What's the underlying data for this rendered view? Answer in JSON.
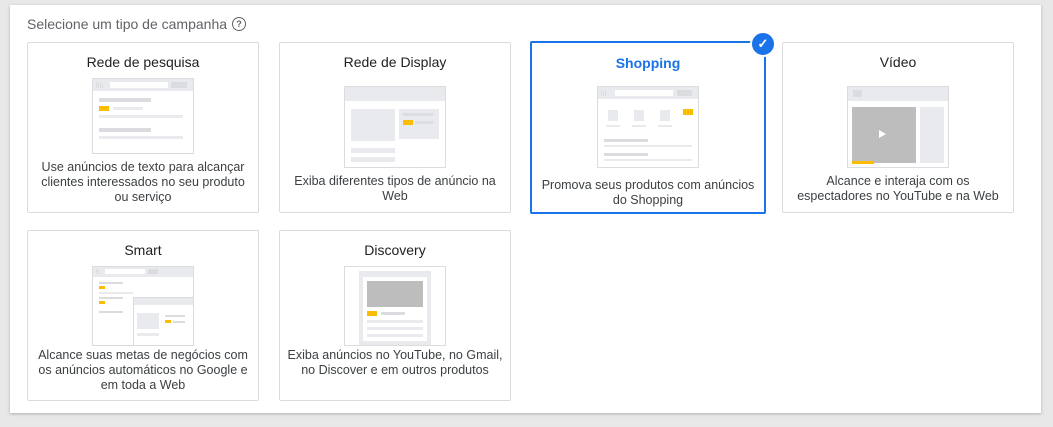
{
  "heading": "Selecione um tipo de campanha",
  "help_icon": "help-circle-icon",
  "accent_color": "#1a73e8",
  "cards": [
    {
      "title": "Rede de pesquisa",
      "description": "Use anúncios de texto para alcançar clientes interessados no seu produto ou serviço",
      "selected": false
    },
    {
      "title": "Rede de Display",
      "description": "Exiba diferentes tipos de anúncio na Web",
      "selected": false
    },
    {
      "title": "Shopping",
      "description": "Promova seus produtos com anúncios do Shopping",
      "selected": true
    },
    {
      "title": "Vídeo",
      "description": "Alcance e interaja com os espectadores no YouTube e na Web",
      "selected": false
    },
    {
      "title": "Smart",
      "description": "Alcance suas metas de negócios com os anúncios automáticos no Google e em toda a Web",
      "selected": false
    },
    {
      "title": "Discovery",
      "description": "Exiba anúncios no YouTube, no Gmail, no Discover e em outros produtos",
      "selected": false
    }
  ]
}
